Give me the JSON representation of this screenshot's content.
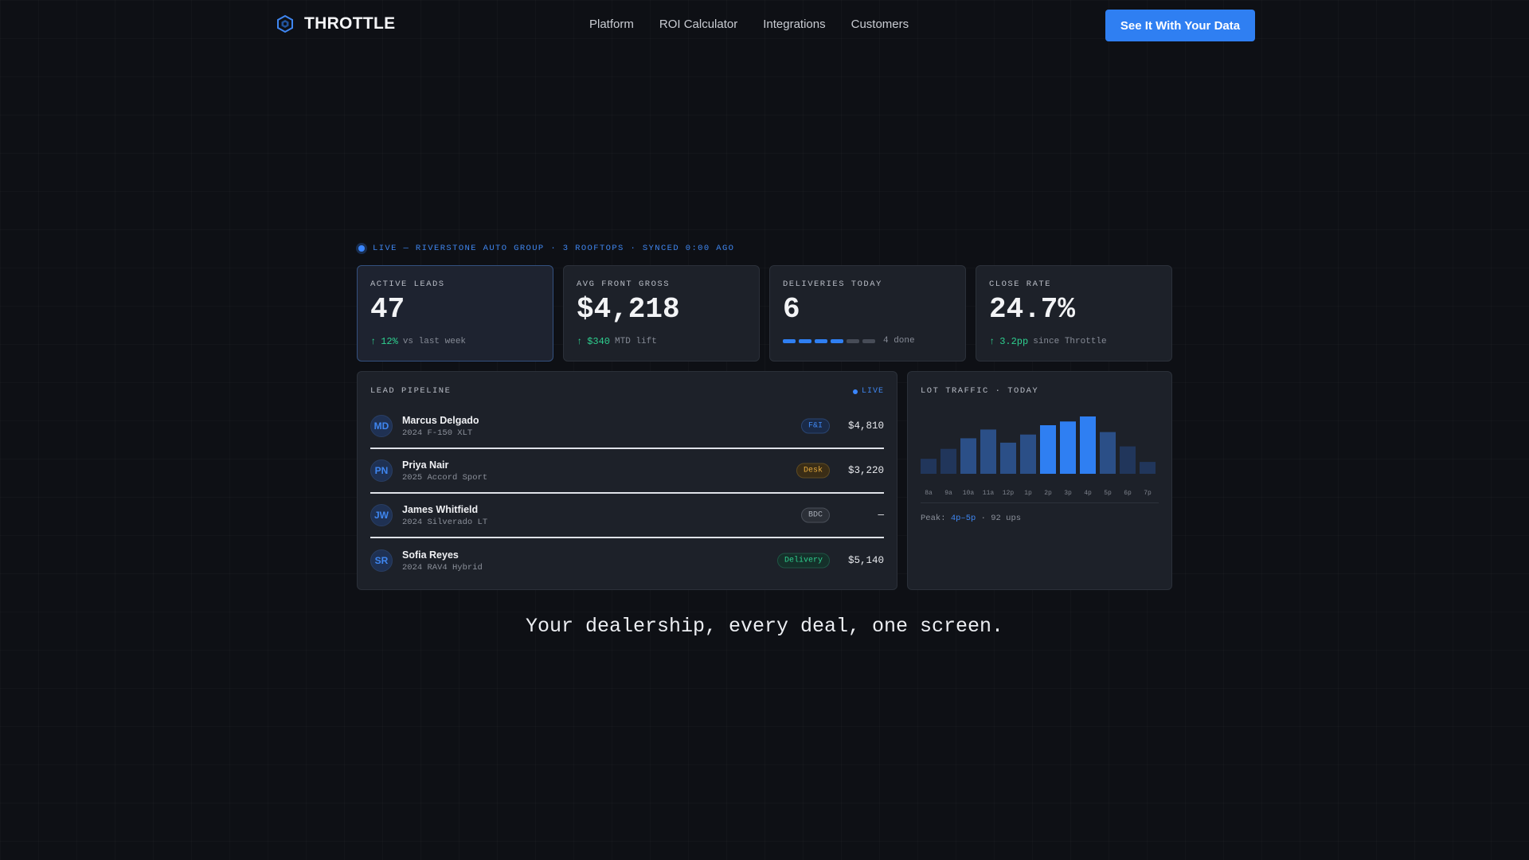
{
  "nav": {
    "brand": "THROTTLE",
    "links": [
      "Platform",
      "ROI Calculator",
      "Integrations",
      "Customers"
    ],
    "cta": "See It With Your Data"
  },
  "status_line": "LIVE — RIVERSTONE AUTO GROUP · 3 ROOFTOPS · SYNCED 0:00 AGO",
  "stats": [
    {
      "label": "ACTIVE LEADS",
      "value": "47",
      "delta": "12%",
      "note": "vs last week"
    },
    {
      "label": "AVG FRONT GROSS",
      "value": "$4,218",
      "delta": "$340",
      "note": "MTD lift"
    },
    {
      "label": "DELIVERIES TODAY",
      "value": "6",
      "progress_done": 4,
      "progress_total": 6,
      "note": "4 done"
    },
    {
      "label": "CLOSE RATE",
      "value": "24.7%",
      "delta": "3.2pp",
      "note": "since Throttle"
    }
  ],
  "pipeline": {
    "title": "LEAD PIPELINE",
    "live_label": "LIVE",
    "rows": [
      {
        "initials": "MD",
        "name": "Marcus Delgado",
        "vehicle": "2024 F-150 XLT",
        "stage": "F&I",
        "stage_kind": "fi",
        "amount": "$4,810"
      },
      {
        "initials": "PN",
        "name": "Priya Nair",
        "vehicle": "2025 Accord Sport",
        "stage": "Desk",
        "stage_kind": "desk",
        "amount": "$3,220"
      },
      {
        "initials": "JW",
        "name": "James Whitfield",
        "vehicle": "2024 Silverado LT",
        "stage": "BDC",
        "stage_kind": "bdc",
        "amount": "—"
      },
      {
        "initials": "SR",
        "name": "Sofia Reyes",
        "vehicle": "2024 RAV4 Hybrid",
        "stage": "Delivery",
        "stage_kind": "delivery",
        "amount": "$5,140"
      }
    ]
  },
  "traffic": {
    "title": "LOT TRAFFIC · TODAY",
    "peak_prefix": "Peak:",
    "peak_window": "4p–5p",
    "peak_suffix": "· 92 ups"
  },
  "chart_data": {
    "type": "bar",
    "categories": [
      "8a",
      "9a",
      "10a",
      "11a",
      "12p",
      "1p",
      "2p",
      "3p",
      "4p",
      "5p",
      "6p",
      "7p"
    ],
    "values": [
      24,
      40,
      57,
      71,
      50,
      63,
      78,
      84,
      92,
      67,
      44,
      19
    ],
    "highlight": [
      6,
      7,
      8
    ],
    "ylim": [
      0,
      92
    ],
    "colors": {
      "base": "#2b4f87",
      "dim": "#21365b",
      "highlight": "#2f7ff2"
    }
  },
  "tagline": "Your dealership, every deal, one screen."
}
